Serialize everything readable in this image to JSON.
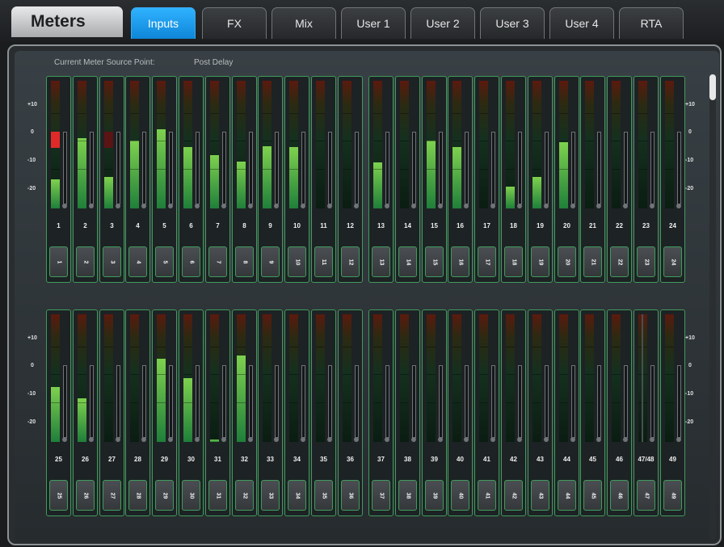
{
  "title": "Meters",
  "tabs": [
    {
      "label": "Inputs",
      "active": true
    },
    {
      "label": "FX",
      "active": false
    },
    {
      "label": "Mix",
      "active": false
    },
    {
      "label": "User 1",
      "active": false
    },
    {
      "label": "User 2",
      "active": false
    },
    {
      "label": "User 3",
      "active": false
    },
    {
      "label": "User 4",
      "active": false
    },
    {
      "label": "RTA",
      "active": false
    }
  ],
  "source_point": {
    "label": "Current Meter Source Point:",
    "value": "Post Delay"
  },
  "scale": [
    "+10",
    "0",
    "-10",
    "-20"
  ],
  "colors": {
    "active_tab": "#1a9cf0",
    "strip_border": "#3f9c5c",
    "meter_green": "#7ed14e",
    "clip_red": "#e02a2a"
  },
  "rows": [
    {
      "channels": [
        {
          "num": "1",
          "btn": "1",
          "level": 0.23,
          "clip": true
        },
        {
          "num": "2",
          "btn": "2",
          "level": 0.55
        },
        {
          "num": "3",
          "btn": "3",
          "level": 0.25,
          "clip_dim": true
        },
        {
          "num": "4",
          "btn": "4",
          "level": 0.53
        },
        {
          "num": "5",
          "btn": "5",
          "level": 0.62
        },
        {
          "num": "6",
          "btn": "6",
          "level": 0.48
        },
        {
          "num": "7",
          "btn": "7",
          "level": 0.42
        },
        {
          "num": "8",
          "btn": "8",
          "level": 0.37
        },
        {
          "num": "9",
          "btn": "9",
          "level": 0.49
        },
        {
          "num": "10",
          "btn": "10",
          "level": 0.48
        },
        {
          "num": "11",
          "btn": "11",
          "level": 0
        },
        {
          "num": "12",
          "btn": "12",
          "level": 0
        },
        {
          "num": "13",
          "btn": "13",
          "level": 0.36
        },
        {
          "num": "14",
          "btn": "14",
          "level": 0
        },
        {
          "num": "15",
          "btn": "15",
          "level": 0.53
        },
        {
          "num": "16",
          "btn": "16",
          "level": 0.48
        },
        {
          "num": "17",
          "btn": "17",
          "level": 0
        },
        {
          "num": "18",
          "btn": "18",
          "level": 0.17
        },
        {
          "num": "19",
          "btn": "19",
          "level": 0.25
        },
        {
          "num": "20",
          "btn": "20",
          "level": 0.52
        },
        {
          "num": "21",
          "btn": "21",
          "level": 0
        },
        {
          "num": "22",
          "btn": "22",
          "level": 0
        },
        {
          "num": "23",
          "btn": "23",
          "level": 0
        },
        {
          "num": "24",
          "btn": "24",
          "level": 0
        }
      ]
    },
    {
      "channels": [
        {
          "num": "25",
          "btn": "25",
          "level": 0.43
        },
        {
          "num": "26",
          "btn": "26",
          "level": 0.34
        },
        {
          "num": "27",
          "btn": "27",
          "level": 0
        },
        {
          "num": "28",
          "btn": "28",
          "level": 0
        },
        {
          "num": "29",
          "btn": "29",
          "level": 0.65
        },
        {
          "num": "30",
          "btn": "30",
          "level": 0.5
        },
        {
          "num": "31",
          "btn": "31",
          "level": 0.02
        },
        {
          "num": "32",
          "btn": "32",
          "level": 0.68
        },
        {
          "num": "33",
          "btn": "33",
          "level": 0
        },
        {
          "num": "34",
          "btn": "34",
          "level": 0
        },
        {
          "num": "35",
          "btn": "35",
          "level": 0
        },
        {
          "num": "36",
          "btn": "36",
          "level": 0
        },
        {
          "num": "37",
          "btn": "37",
          "level": 0
        },
        {
          "num": "38",
          "btn": "38",
          "level": 0
        },
        {
          "num": "39",
          "btn": "39",
          "level": 0
        },
        {
          "num": "40",
          "btn": "40",
          "level": 0
        },
        {
          "num": "41",
          "btn": "41",
          "level": 0
        },
        {
          "num": "42",
          "btn": "42",
          "level": 0
        },
        {
          "num": "43",
          "btn": "43",
          "level": 0
        },
        {
          "num": "44",
          "btn": "44",
          "level": 0
        },
        {
          "num": "45",
          "btn": "45",
          "level": 0
        },
        {
          "num": "46",
          "btn": "46",
          "level": 0
        },
        {
          "num": "47/48",
          "btn": "47",
          "level": 0,
          "stereo": true
        },
        {
          "num": "49",
          "btn": "49",
          "level": 0
        }
      ]
    }
  ]
}
